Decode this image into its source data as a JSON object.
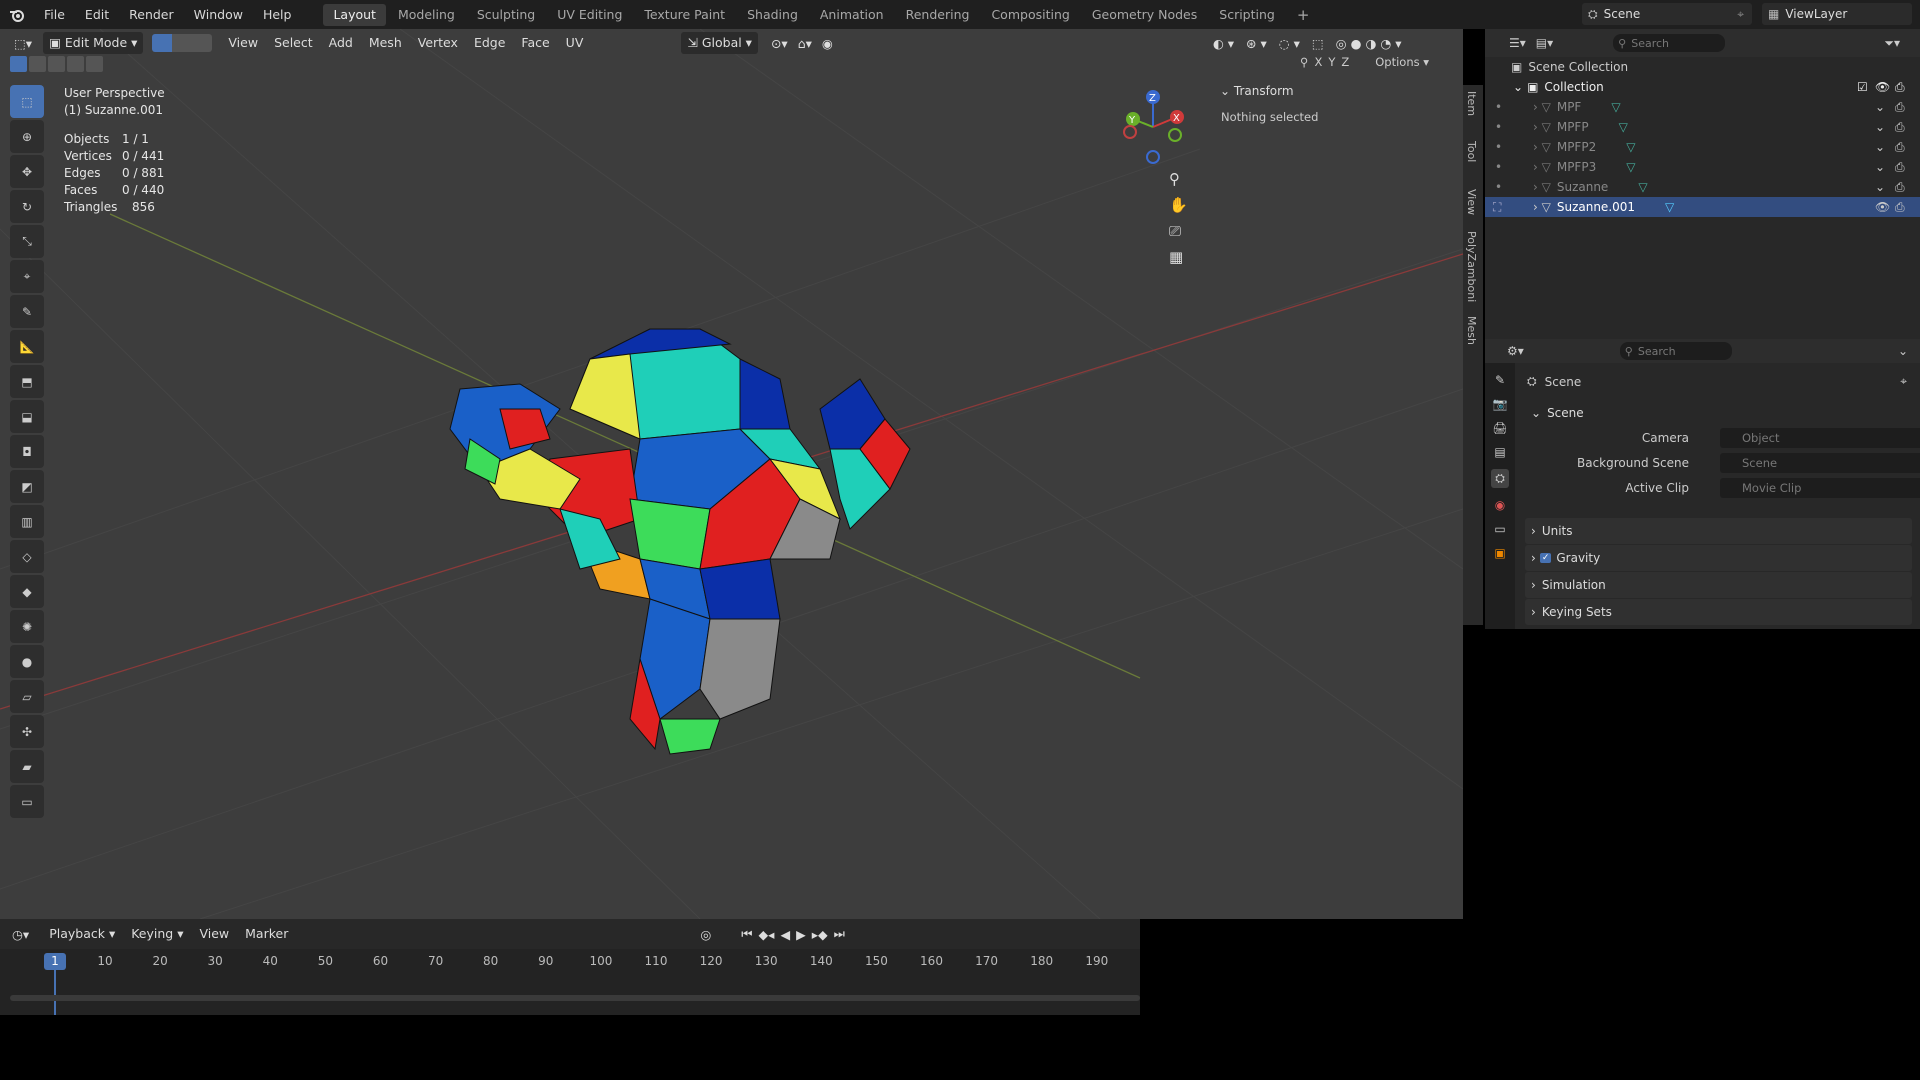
{
  "menubar": {
    "menus": [
      "File",
      "Edit",
      "Render",
      "Window",
      "Help"
    ],
    "workspaces": [
      "Layout",
      "Modeling",
      "Sculpting",
      "UV Editing",
      "Texture Paint",
      "Shading",
      "Animation",
      "Rendering",
      "Compositing",
      "Geometry Nodes",
      "Scripting"
    ],
    "active_workspace": "Layout",
    "scene_name": "Scene",
    "view_layer": "ViewLayer"
  },
  "viewport_header": {
    "mode": "Edit Mode",
    "menus": [
      "View",
      "Select",
      "Add",
      "Mesh",
      "Vertex",
      "Edge",
      "Face",
      "UV"
    ],
    "orientation": "Global",
    "options_label": "Options",
    "axes": [
      "X",
      "Y",
      "Z"
    ]
  },
  "viewport": {
    "perspective": "User Perspective",
    "object_label": "(1) Suzanne.001",
    "stats": [
      {
        "label": "Objects",
        "value": "1 / 1"
      },
      {
        "label": "Vertices",
        "value": "0 / 441"
      },
      {
        "label": "Edges",
        "value": "0 / 881"
      },
      {
        "label": "Faces",
        "value": "0 / 440"
      },
      {
        "label": "Triangles",
        "value": "856"
      }
    ]
  },
  "npanel": {
    "section": "Transform",
    "message": "Nothing selected",
    "tabs": [
      "Item",
      "Tool",
      "View",
      "PolyZamboni",
      "Mesh"
    ]
  },
  "outliner": {
    "search_placeholder": "Search",
    "root": "Scene Collection",
    "collection": "Collection",
    "items": [
      "MPF",
      "MPFP",
      "MPFP2",
      "MPFP3",
      "Suzanne",
      "Suzanne.001"
    ],
    "selected": "Suzanne.001"
  },
  "properties": {
    "search_placeholder": "Search",
    "context": "Scene",
    "panel": "Scene",
    "fields": [
      {
        "label": "Camera",
        "placeholder": "Object"
      },
      {
        "label": "Background Scene",
        "placeholder": "Scene"
      },
      {
        "label": "Active Clip",
        "placeholder": "Movie Clip"
      }
    ],
    "sections": [
      "Units",
      "Gravity",
      "Simulation",
      "Keying Sets"
    ]
  },
  "timeline": {
    "menus": [
      "Playback",
      "Keying",
      "View",
      "Marker"
    ],
    "current_frame": "1",
    "ticks": [
      "10",
      "20",
      "30",
      "40",
      "50",
      "60",
      "70",
      "80",
      "90",
      "100",
      "110",
      "120",
      "130",
      "140",
      "150",
      "160",
      "170",
      "180",
      "190"
    ]
  },
  "colors": {
    "accent": "#4772b3",
    "mesh_colors": [
      "#0b2fa8",
      "#1fcfb8",
      "#e8e84a",
      "#e02020",
      "#f0a020",
      "#8a8a8a",
      "#1a60c8",
      "#3ddc5a"
    ]
  }
}
